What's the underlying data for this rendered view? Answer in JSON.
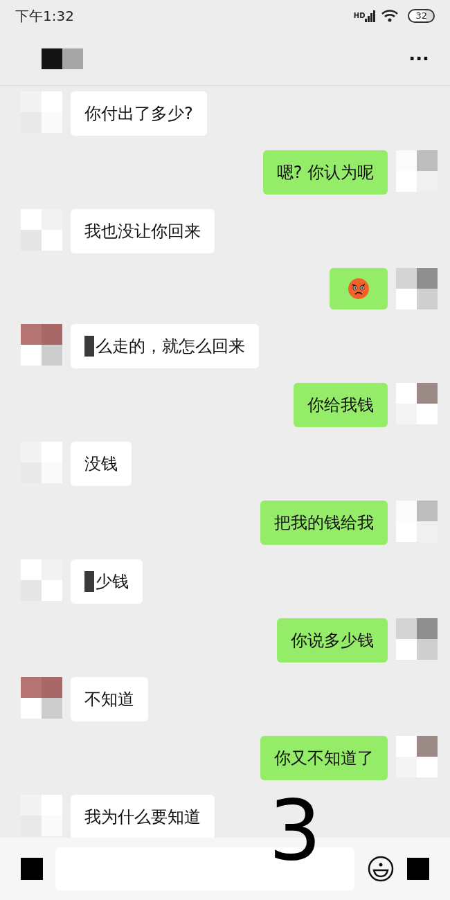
{
  "status_bar": {
    "time": "下午1:32",
    "network": "HD",
    "battery": "32"
  },
  "header": {
    "menu": "···"
  },
  "messages": [
    {
      "outgoing": false,
      "kind": "text",
      "text": "你付出了多少?",
      "redacted_start": false
    },
    {
      "outgoing": true,
      "kind": "text",
      "text": "嗯? 你认为呢",
      "redacted_start": false
    },
    {
      "outgoing": false,
      "kind": "text",
      "text": "我也没让你回来",
      "redacted_start": false
    },
    {
      "outgoing": true,
      "kind": "emoji"
    },
    {
      "outgoing": false,
      "kind": "text",
      "text": "么走的，就怎么回来",
      "redacted_start": true
    },
    {
      "outgoing": true,
      "kind": "text",
      "text": "你给我钱",
      "redacted_start": false
    },
    {
      "outgoing": false,
      "kind": "text",
      "text": "没钱",
      "redacted_start": false
    },
    {
      "outgoing": true,
      "kind": "text",
      "text": "把我的钱给我",
      "redacted_start": false
    },
    {
      "outgoing": false,
      "kind": "text",
      "text": "少钱",
      "redacted_start": true
    },
    {
      "outgoing": true,
      "kind": "text",
      "text": "你说多少钱",
      "redacted_start": false
    },
    {
      "outgoing": false,
      "kind": "text",
      "text": "不知道",
      "redacted_start": false
    },
    {
      "outgoing": true,
      "kind": "text",
      "text": "你又不知道了",
      "redacted_start": false
    },
    {
      "outgoing": false,
      "kind": "text",
      "text": "我为什么要知道",
      "redacted_start": false
    }
  ],
  "overlay_number": "3"
}
